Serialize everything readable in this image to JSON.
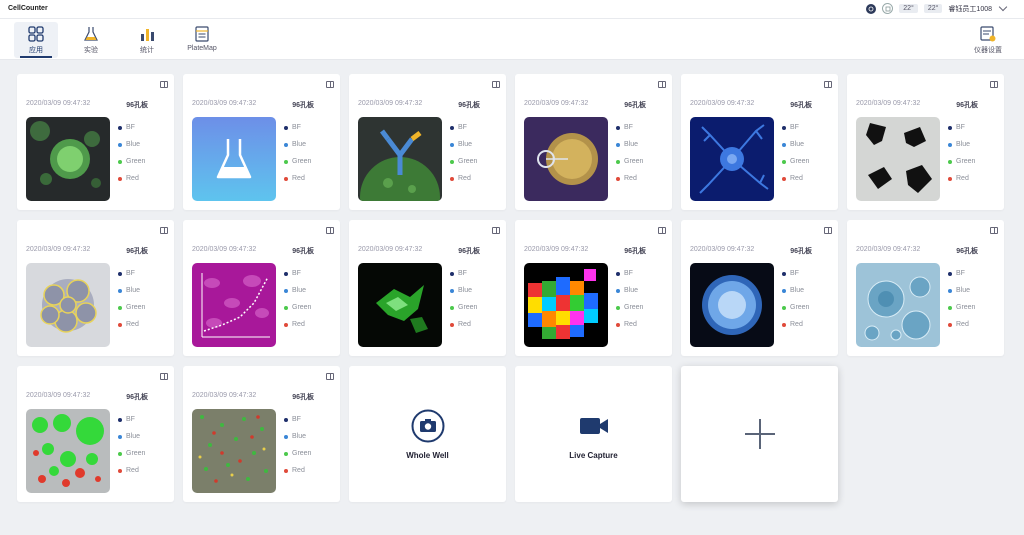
{
  "app": {
    "title": "CellCounter"
  },
  "status": {
    "temp1": "22°",
    "temp2": "22°",
    "user": "睿钰员工1008"
  },
  "nav": {
    "items": [
      {
        "label": "应用",
        "icon": "apps-grid-icon"
      },
      {
        "label": "实验",
        "icon": "flask-icon"
      },
      {
        "label": "统计",
        "icon": "bar-chart-icon"
      },
      {
        "label": "PlateMap",
        "icon": "platemap-icon"
      }
    ],
    "settings_label": "仪器设置"
  },
  "channels": [
    {
      "label": "BF",
      "color": "#1f2f6b"
    },
    {
      "label": "Blue",
      "color": "#3a86d6"
    },
    {
      "label": "Green",
      "color": "#4cc94c"
    },
    {
      "label": "Red",
      "color": "#e04a3a"
    }
  ],
  "cards": [
    {
      "date": "2020/03/09  09:47:32",
      "plate": "96孔板",
      "thumb": "green-cells"
    },
    {
      "date": "2020/03/09  09:47:32",
      "plate": "96孔板",
      "thumb": "flask"
    },
    {
      "date": "2020/03/09  09:47:32",
      "plate": "96孔板",
      "thumb": "antibody"
    },
    {
      "date": "2020/03/09  09:47:32",
      "plate": "96孔板",
      "thumb": "injection"
    },
    {
      "date": "2020/03/09  09:47:32",
      "plate": "96孔板",
      "thumb": "neuron"
    },
    {
      "date": "2020/03/09  09:47:32",
      "plate": "96孔板",
      "thumb": "black-blobs"
    },
    {
      "date": "2020/03/09  09:47:32",
      "plate": "96孔板",
      "thumb": "yellow-cluster"
    },
    {
      "date": "2020/03/09  09:47:32",
      "plate": "96孔板",
      "thumb": "magenta-chart"
    },
    {
      "date": "2020/03/09  09:47:32",
      "plate": "96孔板",
      "thumb": "green-fluor"
    },
    {
      "date": "2020/03/09  09:47:32",
      "plate": "96孔板",
      "thumb": "segmentation"
    },
    {
      "date": "2020/03/09  09:47:32",
      "plate": "96孔板",
      "thumb": "blue-cell"
    },
    {
      "date": "2020/03/09  09:47:32",
      "plate": "96孔板",
      "thumb": "bubbles"
    },
    {
      "date": "2020/03/09  09:47:32",
      "plate": "96孔板",
      "thumb": "green-red-blobs"
    },
    {
      "date": "2020/03/09  09:47:32",
      "plate": "96孔板",
      "thumb": "noisy-field"
    }
  ],
  "actions": {
    "whole_well": "Whole Well",
    "live_capture": "Live Capture"
  },
  "colors": {
    "accent": "#1f3a6e",
    "background": "#eef0f3"
  }
}
